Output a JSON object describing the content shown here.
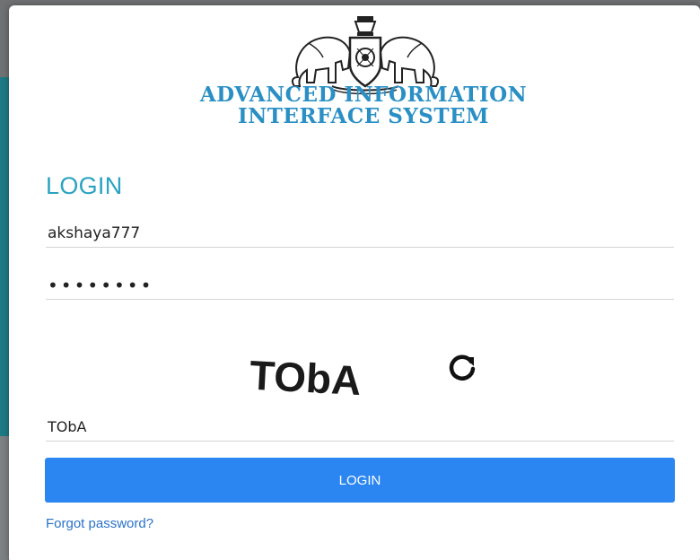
{
  "app": {
    "title_line1": "ADVANCED INFORMATION",
    "title_line2": "INTERFACE SYSTEM",
    "title_color": "#2a8fc4",
    "emblem_icon": "kerala-government-emblem-icon"
  },
  "login": {
    "heading": "LOGIN",
    "heading_color": "#2ba3c1",
    "username_value": "akshaya777",
    "password_value": "••••••••",
    "captcha_text": "TObA",
    "captcha_value": "TObA",
    "refresh_icon": "refresh-icon",
    "submit_label": "LOGIN",
    "submit_color": "#2b86f2",
    "forgot_label": "Forgot password?",
    "link_color": "#2a72c9"
  }
}
